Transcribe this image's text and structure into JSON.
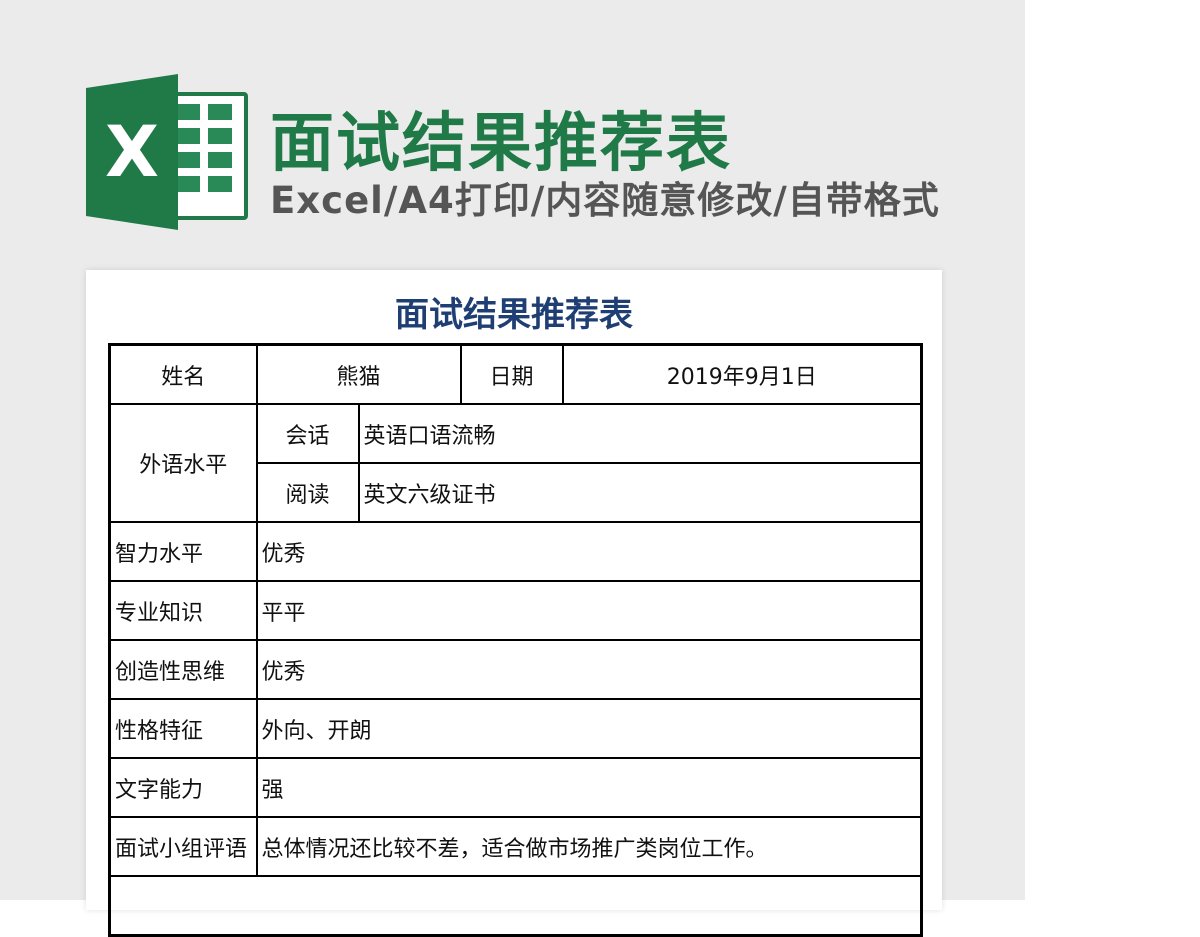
{
  "banner": {
    "title": "面试结果推荐表",
    "subtitle": "Excel/A4打印/内容随意修改/自带格式",
    "logo_letter": "X"
  },
  "colors": {
    "brand_green": "#1f7a48",
    "title_blue": "#1f3e73",
    "subtitle_gray": "#555555"
  },
  "sheet": {
    "title": "面试结果推荐表",
    "name_label": "姓名",
    "name_value": "熊猫",
    "date_label": "日期",
    "date_value": "2019年9月1日",
    "language": {
      "label": "外语水平",
      "speaking_label": "会话",
      "speaking_value": "英语口语流畅",
      "reading_label": "阅读",
      "reading_value": "英文六级证书"
    },
    "rows": [
      {
        "label": "智力水平",
        "value": "优秀"
      },
      {
        "label": "专业知识",
        "value": "平平"
      },
      {
        "label": "创造性思维",
        "value": "优秀"
      },
      {
        "label": "性格特征",
        "value": "外向、开朗"
      },
      {
        "label": "文字能力",
        "value": "强"
      },
      {
        "label": "面试小组评语",
        "value": "总体情况还比较不差，适合做市场推广类岗位工作。"
      }
    ]
  }
}
